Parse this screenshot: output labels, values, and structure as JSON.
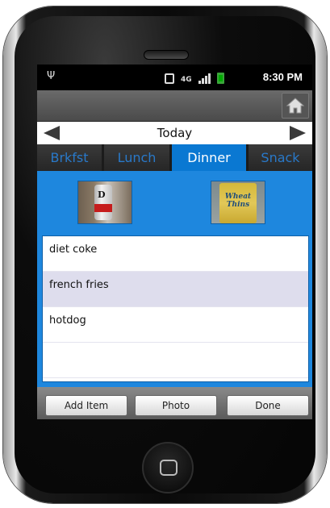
{
  "status": {
    "time": "8:30 PM",
    "network": "4G"
  },
  "date_nav": {
    "label": "Today"
  },
  "tabs": [
    {
      "label": "Brkfst",
      "active": false
    },
    {
      "label": "Lunch",
      "active": false
    },
    {
      "label": "Dinner",
      "active": true
    },
    {
      "label": "Snack",
      "active": false
    }
  ],
  "photos": {
    "coke_logo": "D",
    "wheat_thins_text": "Wheat Thins"
  },
  "items": [
    {
      "label": "diet coke"
    },
    {
      "label": "french fries"
    },
    {
      "label": "hotdog"
    },
    {
      "label": ""
    }
  ],
  "buttons": {
    "add": "Add Item",
    "photo": "Photo",
    "done": "Done"
  },
  "colors": {
    "accent": "#1e87de",
    "active_tab": "#0a78d2",
    "inactive_tab_text": "#2979c9"
  }
}
